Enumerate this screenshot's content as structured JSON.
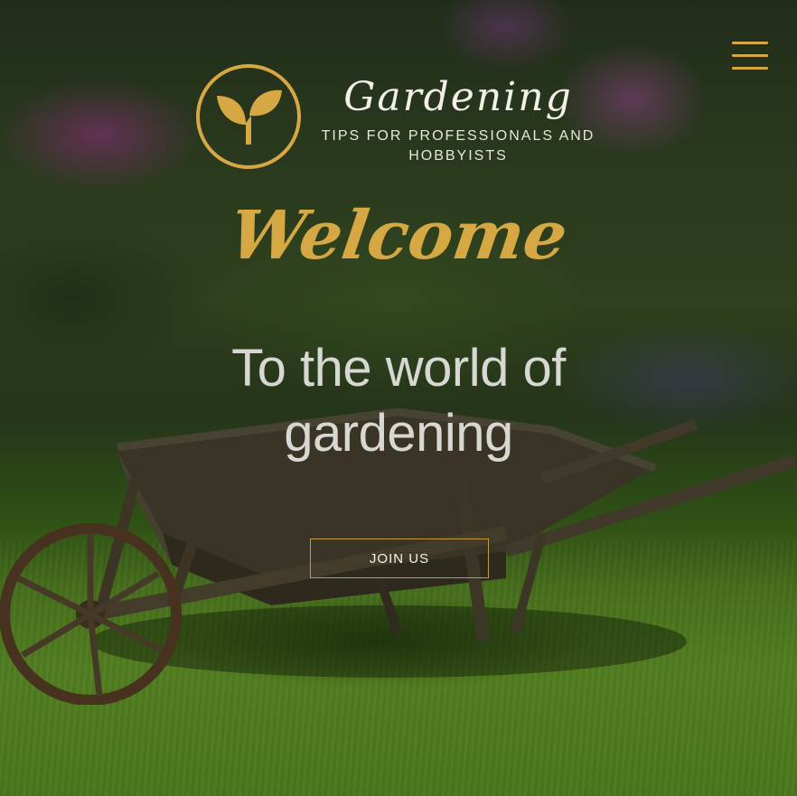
{
  "header": {
    "brand_name": "Gardening",
    "tagline": "TIPS FOR PROFESSIONALS AND HOBBYISTS",
    "logo_icon": "sprout-icon",
    "menu_icon": "hamburger-menu-icon"
  },
  "hero": {
    "welcome": "Welcome",
    "subtitle": "To the world of gardening",
    "cta_label": "JOIN US"
  },
  "colors": {
    "accent": "#d6a844",
    "text_light": "#f2f0e8",
    "subtitle_text": "#d8d8d2"
  }
}
